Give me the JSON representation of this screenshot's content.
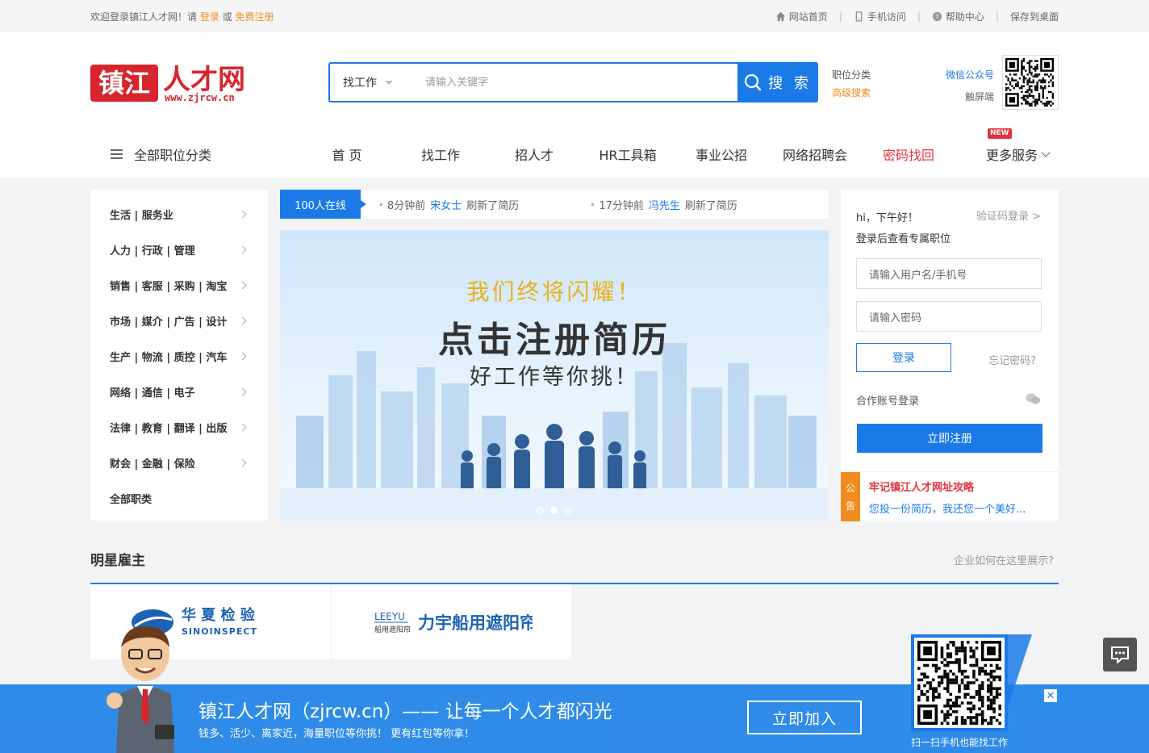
{
  "topbar": {
    "welcome": "欢迎登录镇江人才网！请",
    "login": "登录",
    "or": "或",
    "register": "免费注册",
    "links": [
      "网站首页",
      "手机访问",
      "帮助中心",
      "保存到桌面"
    ]
  },
  "logo": {
    "text_cn": "镇江",
    "text_cn2": "人才网",
    "domain": "www.zjrcw.cn"
  },
  "search": {
    "type": "找工作",
    "placeholder": "请输入关键字",
    "button": "搜 索"
  },
  "adv": {
    "category": "职位分类",
    "advanced": "高级搜索"
  },
  "wx": {
    "official": "微信公众号",
    "touch": "触屏端"
  },
  "nav": {
    "all": "全部职位分类",
    "items": [
      "首 页",
      "找工作",
      "招人才",
      "HR工具箱",
      "事业公招",
      "网络招聘会",
      "密码找回"
    ],
    "more": "更多服务",
    "new_badge": "NEW"
  },
  "categories": [
    "生活 | 服务业",
    "人力 | 行政 | 管理",
    "销售 | 客服 | 采购 | 淘宝",
    "市场 | 媒介 | 广告 | 设计",
    "生产 | 物流 | 质控 | 汽车",
    "网络 | 通信 | 电子",
    "法律 | 教育 | 翻译 | 出版",
    "财会 | 金融 | 保险",
    "全部职类"
  ],
  "ticker": {
    "online": "100人在线",
    "msgs": [
      {
        "time": "8分钟前",
        "name": "宋女士",
        "action": "刷新了简历"
      },
      {
        "time": "17分钟前",
        "name": "冯先生",
        "action": "刷新了简历"
      }
    ]
  },
  "banner": {
    "line1": "我们终将闪耀！",
    "line2": "点击注册简历",
    "line3": "好工作等你挑！"
  },
  "login": {
    "greeting": "hi，下午好！",
    "code_login": "验证码登录 >",
    "sub": "登录后查看专属职位",
    "username_placeholder": "请输入用户名/手机号",
    "password_placeholder": "请输入密码",
    "login_button": "登录",
    "forgot": "忘记密码?",
    "coop": "合作账号登录",
    "register_button": "立即注册",
    "notice_tag1": "公",
    "notice_tag2": "告",
    "notice_title": "牢记镇江人才网址攻略",
    "notice_text": "您投一份简历，我还您一个美好..."
  },
  "star": {
    "title": "明星雇主",
    "how": "企业如何在这里展示?",
    "logo1_cn": "华 夏 检 验",
    "logo1_en": "SINOINSPECT",
    "logo2_brand": "LEEYU",
    "logo2_sub": "船用遮阳帘",
    "logo2_cn": "力宇船用遮阳帘"
  },
  "bottom": {
    "slogan": "镇江人才网（zjrcw.cn）—— 让每一个人才都闪光",
    "small": "钱多、活少、离家近，海量职位等你挑！ 更有红包等你拿！",
    "join": "立即加入",
    "scan": "扫一扫手机也能找工作",
    "close": "✕"
  }
}
